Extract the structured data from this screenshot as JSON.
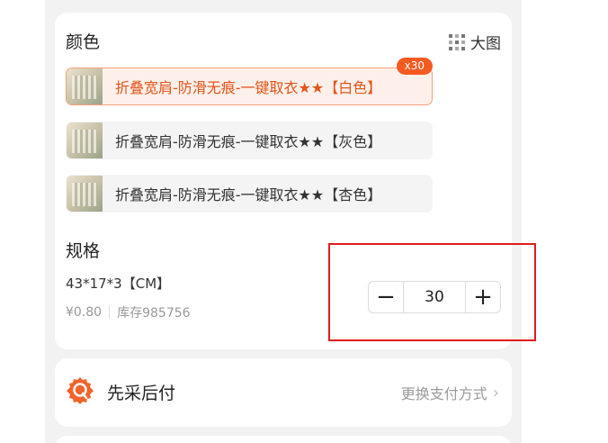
{
  "colors": {
    "title": "颜色",
    "big_view_label": "大图",
    "options": [
      {
        "label": "折叠宽肩-防滑无痕-一键取衣★★【白色】",
        "selected": true,
        "badge": "x30"
      },
      {
        "label": "折叠宽肩-防滑无痕-一键取衣★★【灰色】",
        "selected": false
      },
      {
        "label": "折叠宽肩-防滑无痕-一键取衣★★【杏色】",
        "selected": false
      }
    ]
  },
  "spec": {
    "title": "规格",
    "name": "43*17*3【CM】",
    "price": "¥0.80",
    "stock": "库存985756",
    "quantity": "30",
    "minus": "−",
    "plus": "+"
  },
  "payment": {
    "title": "先采后付",
    "action": "更换支付方式",
    "chevron": "›"
  },
  "theme": {
    "accent": "#f55a20",
    "highlight": "#e11b1b"
  },
  "icons": {
    "grid": "grid-icon",
    "pay": "pay-later-icon"
  }
}
